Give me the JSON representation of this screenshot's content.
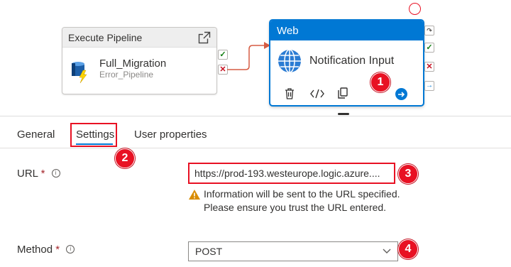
{
  "canvas": {
    "exec_pipeline": {
      "title": "Execute Pipeline",
      "name": "Full_Migration",
      "subtitle": "Error_Pipeline",
      "icons": [
        "open-external-icon",
        "pipeline-icon"
      ]
    },
    "web_activity": {
      "header": "Web",
      "name": "Notification Input",
      "toolbar_icons": [
        "delete-icon",
        "code-icon",
        "copy-icon",
        "arrow-right-icon"
      ]
    },
    "status_buttons": [
      "skip",
      "success",
      "failure",
      "completion"
    ]
  },
  "tabs": [
    {
      "label": "General"
    },
    {
      "label": "Settings"
    },
    {
      "label": "User properties"
    }
  ],
  "form": {
    "url": {
      "label": "URL",
      "required_mark": "*",
      "value": "https://prod-193.westeurope.logic.azure....",
      "warning": "Information will be sent to the URL specified. Please ensure you trust the URL entered."
    },
    "method": {
      "label": "Method",
      "required_mark": "*",
      "value": "POST"
    }
  },
  "callouts": [
    "1",
    "2",
    "3",
    "4"
  ],
  "colors": {
    "accent": "#0078d4",
    "callout": "#e81123",
    "success": "#107c10",
    "failure": "#c50f1f",
    "warning": "#d98c00"
  }
}
